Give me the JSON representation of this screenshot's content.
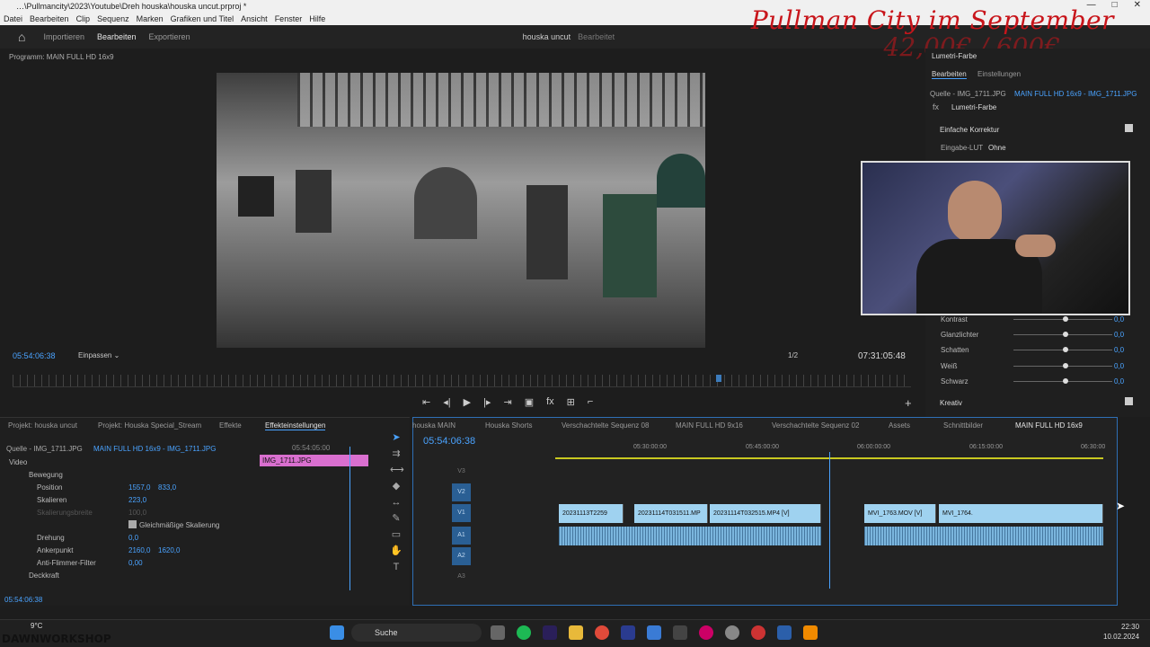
{
  "titlebar": {
    "title": "…\\Pullmancity\\2023\\Youtube\\Dreh houska\\houska uncut.prproj *"
  },
  "menu": [
    "Datei",
    "Bearbeiten",
    "Clip",
    "Sequenz",
    "Marken",
    "Grafiken und Titel",
    "Ansicht",
    "Fenster",
    "Hilfe"
  ],
  "workspace": {
    "tabs": [
      "Importieren",
      "Bearbeiten",
      "Exportieren"
    ],
    "active": "Bearbeiten",
    "project": "houska uncut",
    "project_state": "Bearbeitet"
  },
  "overlay": {
    "title": "Pullman City im September",
    "price": "42,00€ / 600€"
  },
  "program": {
    "label": "Programm: MAIN FULL HD 16x9",
    "timecode": "05:54:06:38",
    "fit": "Einpassen",
    "ratio": "1/2",
    "duration": "07:31:05:48"
  },
  "lumetri": {
    "title": "Lumetri-Farbe",
    "tabs": [
      "Bearbeiten",
      "Einstellungen"
    ],
    "source": "Quelle - IMG_1711.JPG",
    "sequence": "MAIN FULL HD 16x9 - IMG_1711.JPG",
    "effect": "Lumetri-Farbe",
    "section": "Einfache Korrektur",
    "lut_label": "Eingabe-LUT",
    "lut_value": "Ohne",
    "sliders": [
      {
        "label": "Kontrast",
        "value": "0,0",
        "level": 0.5
      },
      {
        "label": "Glanzlichter",
        "value": "0,0",
        "level": 0.5
      },
      {
        "label": "Schatten",
        "value": "0,0",
        "level": 0.5
      },
      {
        "label": "Weiß",
        "value": "0,0",
        "level": 0.5
      },
      {
        "label": "Schwarz",
        "value": "0,0",
        "level": 0.5
      }
    ],
    "kreativ": "Kreativ"
  },
  "bottom_tabs": [
    "Projekt: houska uncut",
    "Projekt: Houska Special_Stream",
    "Effekte",
    "Effekteinstellungen"
  ],
  "effects": {
    "source": "Quelle - IMG_1711.JPG",
    "sequence": "MAIN FULL HD 16x9 - IMG_1711.JPG",
    "mini_tc": "05:54:05:00",
    "clip": "IMG_1711.JPG",
    "video": "Video",
    "bewegung": "Bewegung",
    "rows": [
      {
        "label": "Position",
        "v1": "1557,0",
        "v2": "833,0"
      },
      {
        "label": "Skalieren",
        "v1": "223,0",
        "v2": ""
      },
      {
        "label": "Skalierungsbreite",
        "v1": "100,0",
        "v2": ""
      },
      {
        "label": "Gleichmäßige Skalierung",
        "v1": "",
        "v2": ""
      },
      {
        "label": "Drehung",
        "v1": "0,0",
        "v2": ""
      },
      {
        "label": "Ankerpunkt",
        "v1": "2160,0",
        "v2": "1620,0"
      },
      {
        "label": "Anti-Flimmer-Filter",
        "v1": "0,00",
        "v2": ""
      }
    ],
    "deckkraft": "Deckkraft",
    "bottom_tc": "05:54:06:38"
  },
  "timeline": {
    "tabs": [
      "houska MAIN",
      "Houska Shorts",
      "Verschachtelte Sequenz 08",
      "MAIN FULL HD 9x16",
      "Verschachtelte Sequenz 02",
      "Assets",
      "Schnittbilder",
      "MAIN FULL HD 16x9"
    ],
    "active_tab": "MAIN FULL HD 16x9",
    "timecode": "05:54:06:38",
    "ruler": [
      "05:30:00:00",
      "05:45:00:00",
      "06:00:00:00",
      "06:15:00:00",
      "06:30:00"
    ],
    "tracks": [
      "V3",
      "V2",
      "V1",
      "A1",
      "A2",
      "A3"
    ],
    "clips": [
      "20231113T2259",
      "20231114T031511.MP",
      "20231114T032515.MP4 [V]",
      "MVI_1763.MOV [V]",
      "MVI_1764."
    ]
  },
  "taskbar": {
    "weather": "9°C",
    "search": "Suche",
    "time": "22:30",
    "date": "10.02.2024",
    "brand": "DAWNWORKSHOP"
  }
}
